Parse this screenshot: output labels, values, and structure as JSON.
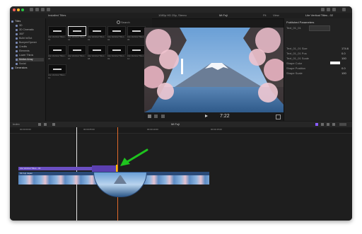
{
  "window": {
    "title": "1080p HD 25p, Stereo",
    "project_name": "Mt Fuji",
    "inspector_title": "Lite Vertical Titles - 02"
  },
  "toolbar": {
    "colors": {
      "close": "#fe5f57",
      "minimize": "#febc2e",
      "maximize": "#28c840"
    }
  },
  "sidebar": {
    "items": [
      {
        "label": "Titles"
      },
      {
        "label": "3D"
      },
      {
        "label": "3D Cinematic"
      },
      {
        "label": "360°"
      },
      {
        "label": "Build In/Out"
      },
      {
        "label": "Bumper/Opener"
      },
      {
        "label": "Credits"
      },
      {
        "label": "Elements"
      },
      {
        "label": "Lower Thirds"
      },
      {
        "label": "Motion Array"
      },
      {
        "label": "Social"
      },
      {
        "label": "Generators"
      }
    ]
  },
  "browser": {
    "header": "Installed Titles",
    "search_placeholder": "Search",
    "thumbs": [
      {
        "caption": "Lite Vertical Titles - 01"
      },
      {
        "caption": "Lite Vertical Titles - 02"
      },
      {
        "caption": "Lite Vertical Titles - 03"
      },
      {
        "caption": "Lite Vertical Titles - 04"
      },
      {
        "caption": "Lite Vertical Titles - 05"
      },
      {
        "caption": "Lite Vertical Titles - 06"
      },
      {
        "caption": "Lite Vertical Titles - 07"
      },
      {
        "caption": "Lite Vertical Titles - 08"
      },
      {
        "caption": "Lite Vertical Titles - 09"
      },
      {
        "caption": "Lite Vertical Titles - 10"
      },
      {
        "caption": "Lite Vertical Titles - 11"
      }
    ]
  },
  "viewer": {
    "timecode": "7:22",
    "zoom": "Fit",
    "view_label": "View"
  },
  "inspector": {
    "section": "Published Parameters",
    "rows": [
      {
        "label": "Text_01_01",
        "value": ""
      },
      {
        "label": "Text_01_01 Size",
        "value": "174.6"
      },
      {
        "label": "Text_01_01 Pos",
        "value": "0.0"
      },
      {
        "label": "Text_01_01 Scale",
        "value": "100"
      },
      {
        "label": "Shape Color",
        "value": ""
      },
      {
        "label": "Shape Position",
        "value": "0.0"
      },
      {
        "label": "Shape Scale",
        "value": "100"
      }
    ]
  },
  "timeline": {
    "index_label": "Index",
    "project": "Mt Fuji",
    "ruler_marks": [
      "00:00:00:00",
      "00:00:05:00",
      "00:00:10:00",
      "00:00:15:00"
    ],
    "title_clip_label": "Lite Vertical Titles - 02",
    "video_clip_label": "Mt Fuji Japan"
  }
}
